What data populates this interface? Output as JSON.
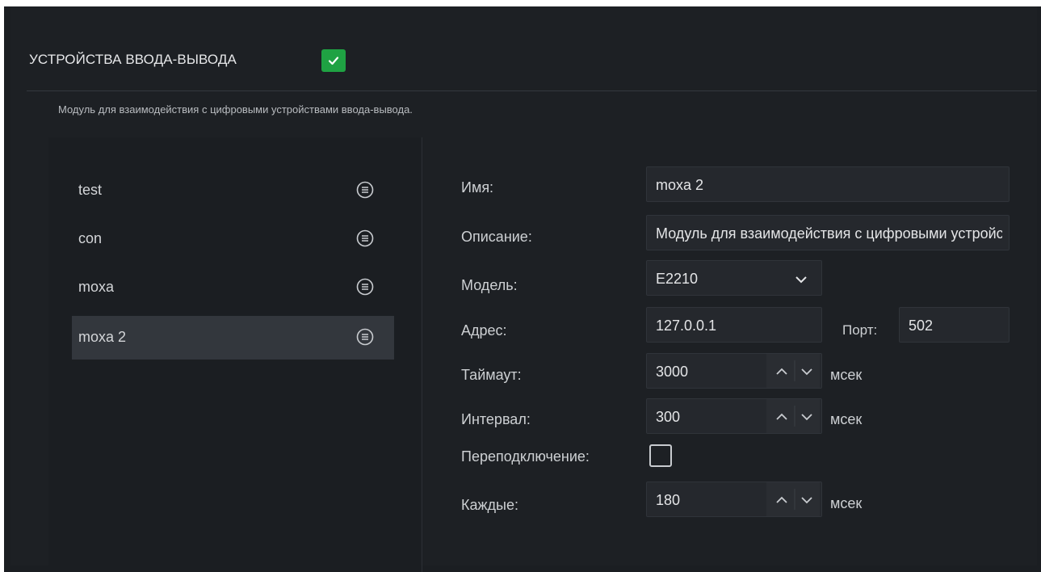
{
  "header": {
    "title": "УСТРОЙСТВА ВВОДА-ВЫВОДА",
    "enabled": true,
    "description": "Модуль для взаимодействия с цифровыми устройствами ввода-вывода."
  },
  "devices": [
    {
      "name": "test",
      "selected": false
    },
    {
      "name": "con",
      "selected": false
    },
    {
      "name": "moxa",
      "selected": false
    },
    {
      "name": "moxa 2",
      "selected": true
    }
  ],
  "form": {
    "name_label": "Имя:",
    "name_value": "moxa 2",
    "description_label": "Описание:",
    "description_value": "Модуль для взаимодействия с цифровыми устройствами ввода-вывода.",
    "model_label": "Модель:",
    "model_value": "E2210",
    "address_label": "Адрес:",
    "address_value": "127.0.0.1",
    "port_label": "Порт:",
    "port_value": "502",
    "timeout_label": "Таймаут:",
    "timeout_value": "3000",
    "timeout_unit": "мсек",
    "interval_label": "Интервал:",
    "interval_value": "300",
    "interval_unit": "мсек",
    "reconnect_label": "Переподключение:",
    "reconnect_checked": false,
    "every_label": "Каждые:",
    "every_value": "180",
    "every_unit": "мсек"
  },
  "colors": {
    "accent_check": "#1fa243",
    "background": "#1d2024",
    "selected_row": "#33373d"
  }
}
